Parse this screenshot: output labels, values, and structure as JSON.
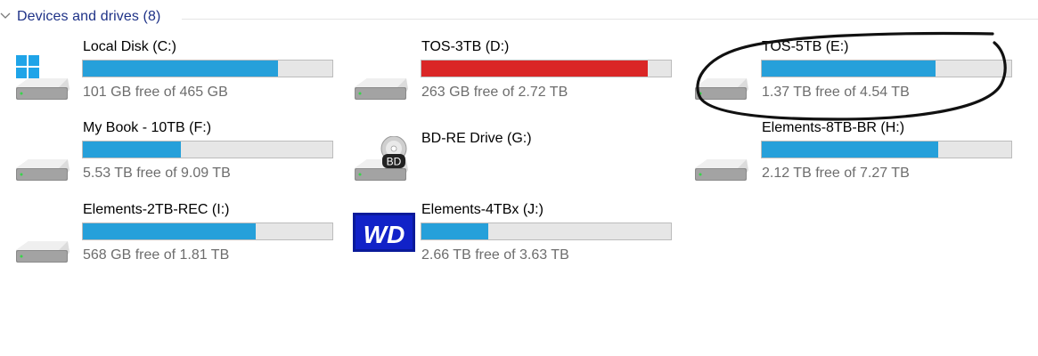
{
  "group": {
    "title": "Devices and drives (8)"
  },
  "drives": [
    {
      "name": "Local Disk (C:)",
      "free_text": "101 GB free of 465 GB",
      "used_fraction": 0.783,
      "bar_color": "#26a0da",
      "icon": "windows-drive-icon"
    },
    {
      "name": "TOS-3TB (D:)",
      "free_text": "263 GB free of 2.72 TB",
      "used_fraction": 0.906,
      "bar_color": "#da2626",
      "icon": "hard-drive-icon"
    },
    {
      "name": "TOS-5TB (E:)",
      "free_text": "1.37 TB free of 4.54 TB",
      "used_fraction": 0.698,
      "bar_color": "#26a0da",
      "icon": "hard-drive-icon"
    },
    {
      "name": "My Book - 10TB (F:)",
      "free_text": "5.53 TB free of 9.09 TB",
      "used_fraction": 0.392,
      "bar_color": "#26a0da",
      "icon": "hard-drive-icon"
    },
    {
      "name": "BD-RE Drive (G:)",
      "icon": "bd-disc-drive-icon"
    },
    {
      "name": "Elements-8TB-BR (H:)",
      "free_text": "2.12 TB free of 7.27 TB",
      "used_fraction": 0.708,
      "bar_color": "#26a0da",
      "icon": "hard-drive-icon"
    },
    {
      "name": "Elements-2TB-REC (I:)",
      "free_text": "568 GB free of 1.81 TB",
      "used_fraction": 0.693,
      "bar_color": "#26a0da",
      "icon": "hard-drive-icon"
    },
    {
      "name": "Elements-4TBx (J:)",
      "free_text": "2.66 TB free of 3.63 TB",
      "used_fraction": 0.267,
      "bar_color": "#26a0da",
      "icon": "wd-logo-icon"
    }
  ],
  "bd_badge": "BD",
  "wd_logo_text": "WD"
}
